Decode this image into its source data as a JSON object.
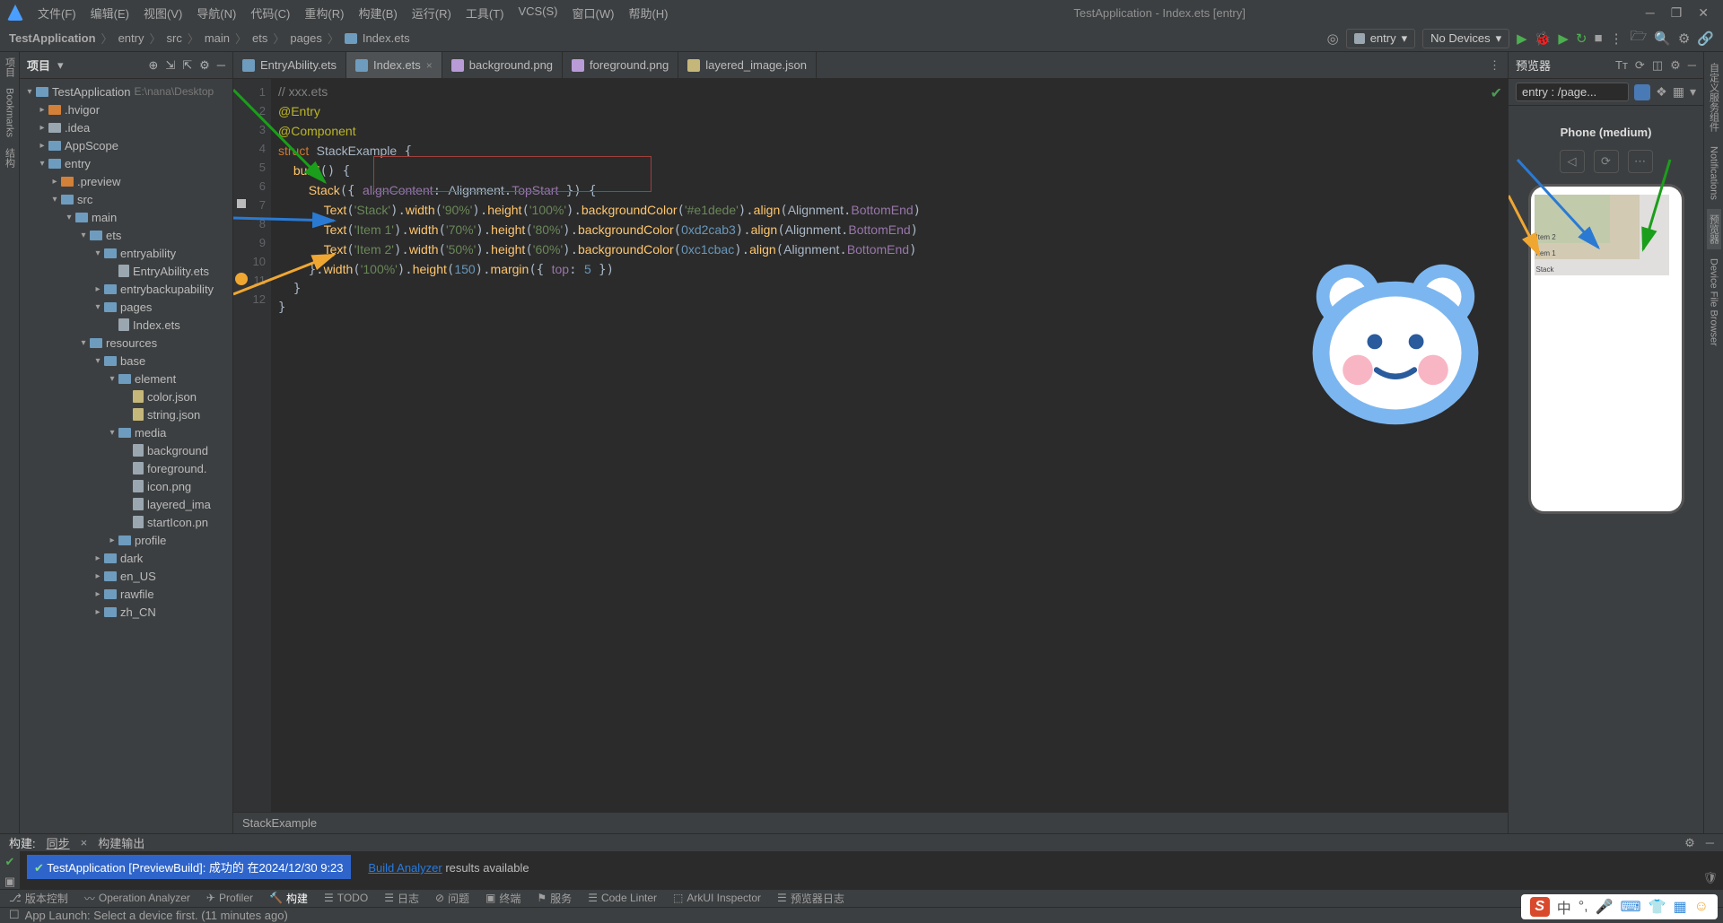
{
  "window": {
    "title": "TestApplication - Index.ets [entry]"
  },
  "menus": [
    "文件(F)",
    "编辑(E)",
    "视图(V)",
    "导航(N)",
    "代码(C)",
    "重构(R)",
    "构建(B)",
    "运行(R)",
    "工具(T)",
    "VCS(S)",
    "窗口(W)",
    "帮助(H)"
  ],
  "breadcrumb": [
    "TestApplication",
    "entry",
    "src",
    "main",
    "ets",
    "pages",
    "Index.ets"
  ],
  "runConfig": {
    "module": "entry",
    "device": "No Devices"
  },
  "sidebars": {
    "left": [
      "项目",
      "Bookmarks",
      "结构"
    ],
    "right": [
      "自定义服务组件",
      "Notifications",
      "预览器",
      "Device File Browser"
    ]
  },
  "projectPanel": {
    "title": "项目"
  },
  "tree": [
    {
      "d": 0,
      "a": "▾",
      "i": "blue",
      "n": "TestApplication",
      "dim": "E:\\nana\\Desktop"
    },
    {
      "d": 1,
      "a": "▸",
      "i": "orange",
      "n": ".hvigor"
    },
    {
      "d": 1,
      "a": "▸",
      "i": "grey",
      "n": ".idea"
    },
    {
      "d": 1,
      "a": "▸",
      "i": "blue",
      "n": "AppScope"
    },
    {
      "d": 1,
      "a": "▾",
      "i": "blue",
      "n": "entry"
    },
    {
      "d": 2,
      "a": "▸",
      "i": "orange",
      "n": ".preview"
    },
    {
      "d": 2,
      "a": "▾",
      "i": "blue",
      "n": "src"
    },
    {
      "d": 3,
      "a": "▾",
      "i": "blue",
      "n": "main"
    },
    {
      "d": 4,
      "a": "▾",
      "i": "blue",
      "n": "ets"
    },
    {
      "d": 5,
      "a": "▾",
      "i": "blue",
      "n": "entryability"
    },
    {
      "d": 6,
      "a": "",
      "i": "file",
      "n": "EntryAbility.ets"
    },
    {
      "d": 5,
      "a": "▸",
      "i": "blue",
      "n": "entrybackupability"
    },
    {
      "d": 5,
      "a": "▾",
      "i": "blue",
      "n": "pages"
    },
    {
      "d": 6,
      "a": "",
      "i": "file",
      "n": "Index.ets"
    },
    {
      "d": 4,
      "a": "▾",
      "i": "blue",
      "n": "resources"
    },
    {
      "d": 5,
      "a": "▾",
      "i": "blue",
      "n": "base"
    },
    {
      "d": 6,
      "a": "▾",
      "i": "blue",
      "n": "element"
    },
    {
      "d": 7,
      "a": "",
      "i": "json",
      "n": "color.json"
    },
    {
      "d": 7,
      "a": "",
      "i": "json",
      "n": "string.json"
    },
    {
      "d": 6,
      "a": "▾",
      "i": "blue",
      "n": "media"
    },
    {
      "d": 7,
      "a": "",
      "i": "file",
      "n": "background"
    },
    {
      "d": 7,
      "a": "",
      "i": "file",
      "n": "foreground."
    },
    {
      "d": 7,
      "a": "",
      "i": "file",
      "n": "icon.png"
    },
    {
      "d": 7,
      "a": "",
      "i": "file",
      "n": "layered_ima"
    },
    {
      "d": 7,
      "a": "",
      "i": "file",
      "n": "startIcon.pn"
    },
    {
      "d": 6,
      "a": "▸",
      "i": "blue",
      "n": "profile"
    },
    {
      "d": 5,
      "a": "▸",
      "i": "blue",
      "n": "dark"
    },
    {
      "d": 5,
      "a": "▸",
      "i": "blue",
      "n": "en_US"
    },
    {
      "d": 5,
      "a": "▸",
      "i": "blue",
      "n": "rawfile"
    },
    {
      "d": 5,
      "a": "▸",
      "i": "blue",
      "n": "zh_CN"
    }
  ],
  "editorTabs": [
    {
      "icon": "ets",
      "label": "EntryAbility.ets",
      "active": false
    },
    {
      "icon": "ets",
      "label": "Index.ets",
      "active": true
    },
    {
      "icon": "png",
      "label": "background.png",
      "active": false
    },
    {
      "icon": "png",
      "label": "foreground.png",
      "active": false
    },
    {
      "icon": "json",
      "label": "layered_image.json",
      "active": false
    }
  ],
  "breadcrumbBar": "StackExample",
  "code": {
    "lines": [
      1,
      2,
      3,
      4,
      5,
      6,
      7,
      8,
      9,
      10,
      11,
      12
    ]
  },
  "preview": {
    "title": "预览器",
    "entry": "entry : /page...",
    "device": "Phone (medium)",
    "stackLabels": [
      "Item 2",
      "Item 1",
      "Stack"
    ]
  },
  "build": {
    "tabs": {
      "t1": "构建:",
      "t2": "同步",
      "t3": "构建输出"
    },
    "task": "TestApplication [PreviewBuild]: 成功的 在2024/12/30 9:23",
    "analyzer": "Build Analyzer",
    "rest": " results available"
  },
  "bottomTools": [
    "版本控制",
    "Operation Analyzer",
    "Profiler",
    "构建",
    "TODO",
    "日志",
    "问题",
    "终端",
    "服务",
    "Code Linter",
    "ArkUI Inspector",
    "预览器日志"
  ],
  "status": "App Launch: Select a device first. (11 minutes ago)"
}
